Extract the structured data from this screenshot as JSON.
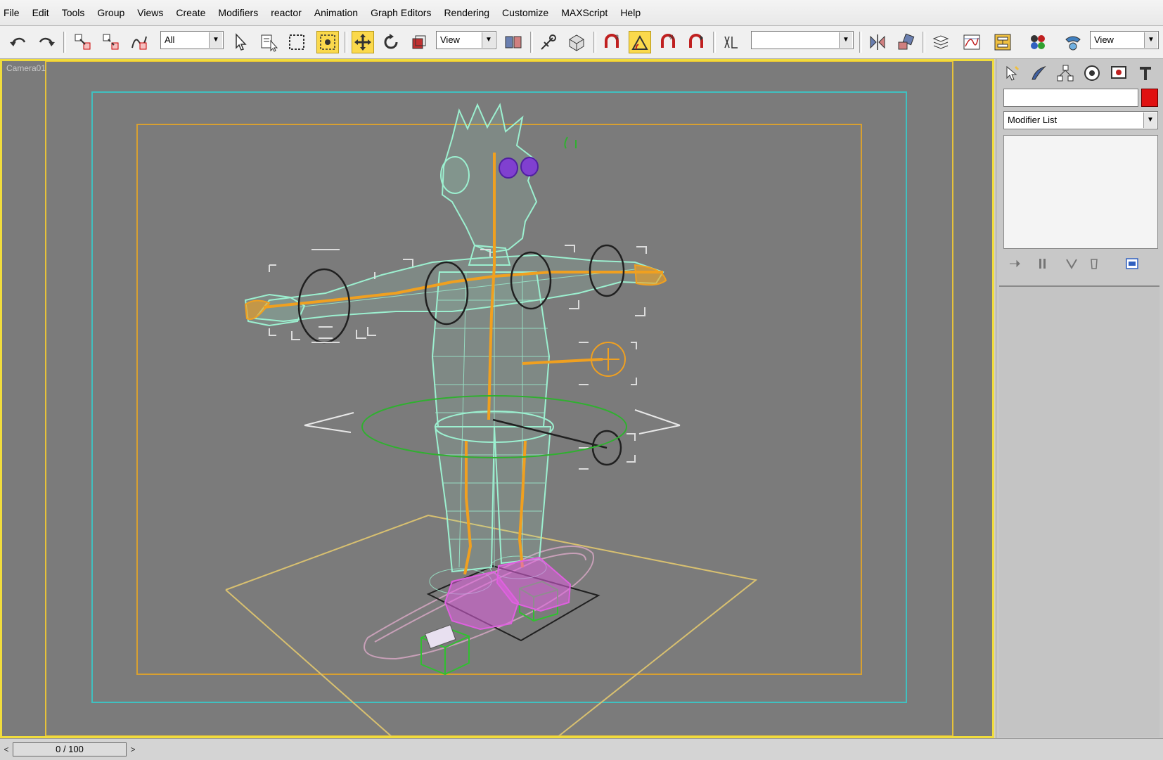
{
  "menu": [
    "File",
    "Edit",
    "Tools",
    "Group",
    "Views",
    "Create",
    "Modifiers",
    "reactor",
    "Animation",
    "Graph Editors",
    "Rendering",
    "Customize",
    "MAXScript",
    "Help"
  ],
  "toolbar": {
    "selection_filter": "All",
    "ref_coord_1": "View",
    "ref_coord_2": "View",
    "named_selection": "",
    "icons": {
      "undo": "undo-icon",
      "redo": "redo-icon",
      "link": "select-and-link-icon",
      "unlink": "unlink-icon",
      "bind": "bind-to-space-warp-icon",
      "select": "select-object-icon",
      "select_by_name": "select-by-name-icon",
      "region": "rectangular-selection-icon",
      "window_crossing": "window-crossing-icon",
      "move": "select-and-move-icon",
      "rotate": "select-and-rotate-icon",
      "scale": "select-and-scale-icon",
      "pivot": "use-pivot-center-icon",
      "manipulate": "select-and-manipulate-icon",
      "keyboard": "keyboard-shortcut-override-icon",
      "snap": "snaps-toggle-icon",
      "angle_snap": "angle-snap-icon",
      "percent_snap": "percent-snap-icon",
      "spinner_snap": "spinner-snap-icon",
      "edit_named": "edit-named-selection-icon",
      "mirror": "mirror-icon",
      "align": "align-icon",
      "layers": "layer-manager-icon",
      "curve_editor": "curve-editor-icon",
      "schematic": "schematic-view-icon",
      "material": "material-editor-icon",
      "render_scene": "render-setup-icon",
      "quick_render": "quick-render-icon"
    },
    "active": [
      "select-and-move-icon",
      "snaps-toggle-icon"
    ]
  },
  "viewport": {
    "label": "Camera01",
    "border_color": "#f0dc3c",
    "background": "#7b7b7b",
    "character_wire": "#9cf0d0",
    "bones_color": "#f0a020",
    "shoe_color": "#e060e0",
    "eye_color": "#8040d0"
  },
  "command_panel": {
    "tabs": [
      "create-tab-icon",
      "modify-tab-icon",
      "hierarchy-tab-icon",
      "motion-tab-icon",
      "display-tab-icon",
      "utilities-tab-icon"
    ],
    "object_name": "",
    "object_color": "#e01010",
    "modifier_list": "Modifier List"
  },
  "time_slider": {
    "frame_text": "0 / 100",
    "prev": "<",
    "next": ">"
  }
}
